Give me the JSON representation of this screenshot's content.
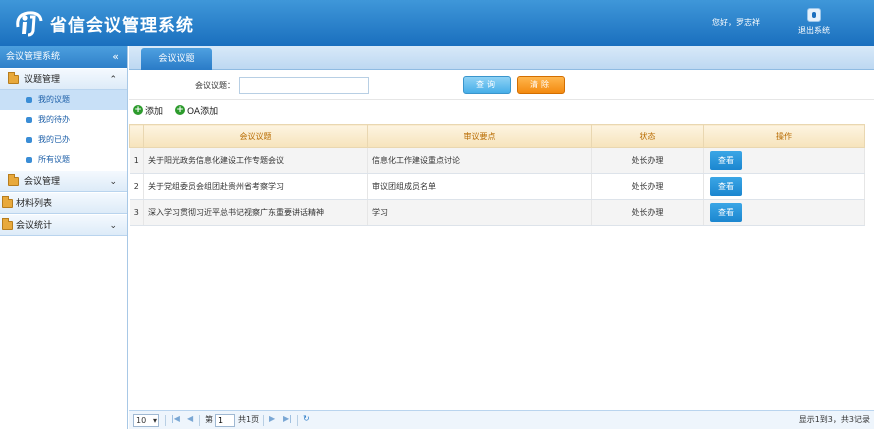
{
  "header": {
    "title": "省信会议管理系统",
    "greeting": "您好，罗志祥",
    "logout_label": "退出系统"
  },
  "sidebar": {
    "title": "会议管理系统",
    "groups": [
      {
        "label": "议题管理",
        "expanded": true,
        "items": [
          {
            "label": "我的议题",
            "active": true
          },
          {
            "label": "我的待办"
          },
          {
            "label": "我的已办"
          },
          {
            "label": "所有议题"
          }
        ]
      },
      {
        "label": "会议管理",
        "expanded": false
      },
      {
        "label": "材料列表"
      },
      {
        "label": "会议统计",
        "expanded": false
      }
    ]
  },
  "main": {
    "tab_label": "会议议题",
    "search": {
      "label": "会议议题：",
      "value": ""
    },
    "query_label": "查询",
    "clear_label": "清除",
    "add_label": "添加",
    "oa_add_label": "OA添加",
    "table": {
      "columns": [
        "会议议题",
        "审议要点",
        "状态",
        "操作"
      ],
      "rows": [
        {
          "no": "1",
          "topic": "关于阳光政务信息化建设工作专题会议",
          "points": "信息化工作建设重点讨论",
          "status": "处长办理",
          "action": "查看"
        },
        {
          "no": "2",
          "topic": "关于党组委员会组团赴贵州省考察学习",
          "points": "审议团组成员名单",
          "status": "处长办理",
          "action": "查看"
        },
        {
          "no": "3",
          "topic": "深入学习贯彻习近平总书记视察广东重要讲话精神",
          "points": "学习",
          "status": "处长办理",
          "action": "查看"
        }
      ]
    },
    "pager": {
      "page_size": "10",
      "page_prefix": "第",
      "page_value": "1",
      "page_suffix": "共1页",
      "summary": "显示1到3，共3记录"
    }
  },
  "colors": {
    "header": "#1a6fbe",
    "accent": "#2a7bc7",
    "clear_button": "#f38a10",
    "add_icon": "#2d9b2d",
    "table_header_text": "#b86b00"
  }
}
